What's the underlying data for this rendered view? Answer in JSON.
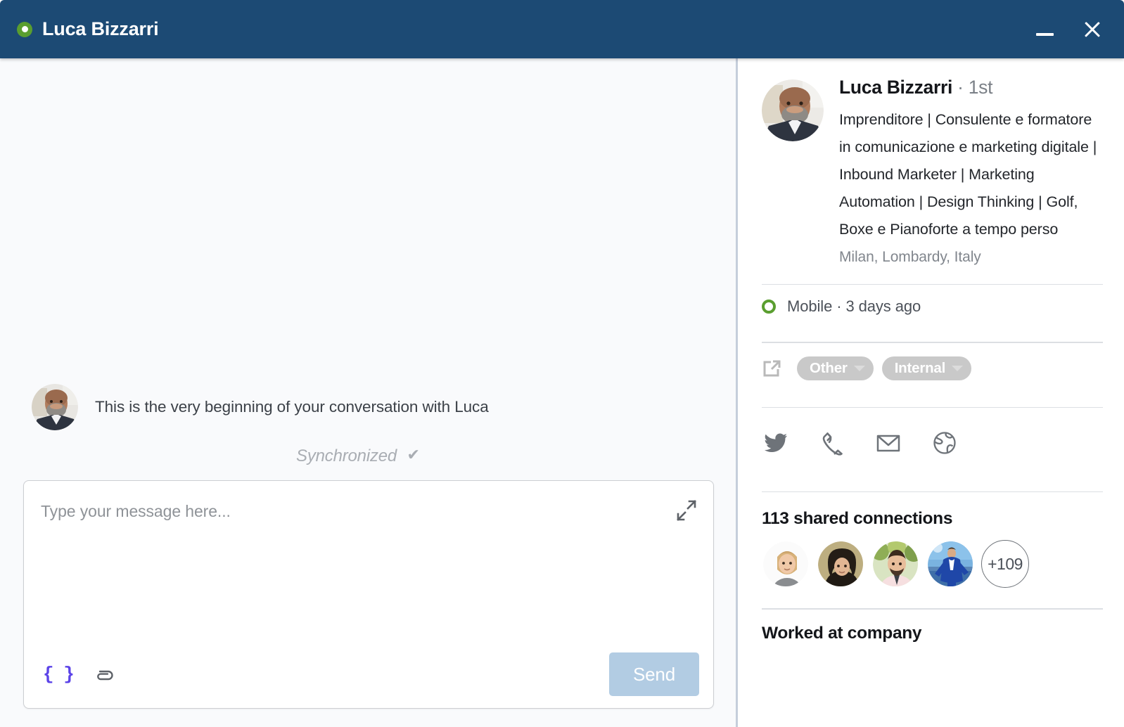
{
  "window": {
    "title": "Luca Bizzarri",
    "status_icon": "online-dot-icon",
    "minimize_label": "minimize-icon",
    "close_label": "close-icon",
    "header_color": "#1c4a74",
    "status_color": "#5a9e2f"
  },
  "conversation": {
    "start_text": "This is the very beginning of your conversation with Luca",
    "sync_label": "Synchronized",
    "sync_check": "✔"
  },
  "composer": {
    "placeholder": "Type your message here...",
    "value": "",
    "expand_icon": "expand-arrows-icon",
    "snippet_label": "{ }",
    "attach_icon": "paperclip-icon",
    "send_label": "Send",
    "send_color": "#b2cce3"
  },
  "profile": {
    "avatar": "profile-photo",
    "name": "Luca Bizzarri",
    "degree": " · 1st",
    "headline": "Imprenditore | Consulente e formatore in comunicazione e marketing digitale | Inbound Marketer | Marketing Automation | Design Thinking | Golf, Boxe e Pianoforte a tempo perso",
    "location": "Milan, Lombardy, Italy",
    "presence": {
      "icon": "green-ring-icon",
      "text": "Mobile · 3 days ago"
    },
    "tags": {
      "external_link_icon": "external-link-icon",
      "items": [
        {
          "label": "Other",
          "caret": "chevron-down-icon"
        },
        {
          "label": "Internal",
          "caret": "chevron-down-icon"
        }
      ]
    },
    "socials": [
      {
        "name": "twitter-icon"
      },
      {
        "name": "phone-icon"
      },
      {
        "name": "email-icon"
      },
      {
        "name": "globe-icon"
      }
    ],
    "shared": {
      "title": "113 shared connections",
      "count": 113,
      "avatars": [
        {
          "name": "connection-avatar-1"
        },
        {
          "name": "connection-avatar-2"
        },
        {
          "name": "connection-avatar-3"
        },
        {
          "name": "connection-avatar-4"
        }
      ],
      "more_label": "+109"
    },
    "bottom_section_title": "Worked at company"
  }
}
